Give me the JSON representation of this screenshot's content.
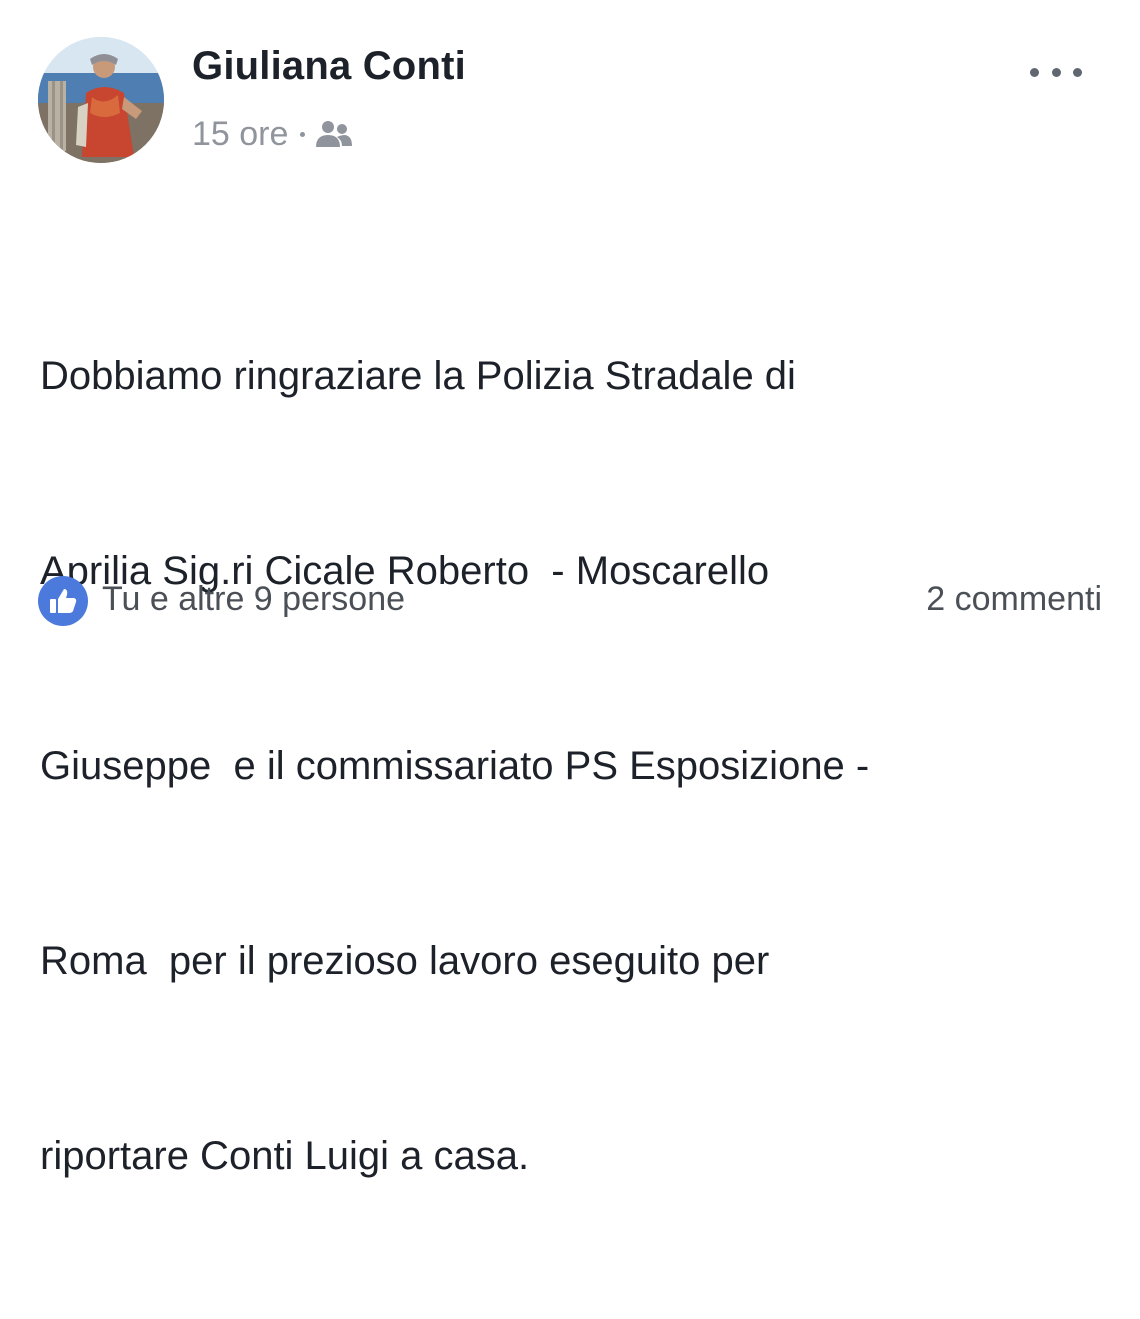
{
  "post": {
    "author": "Giuliana Conti",
    "time": "15 ore",
    "audience_icon": "friends-icon",
    "more_icon": "more-options-icon",
    "text_lines": [
      "Dobbiamo ringraziare la Polizia Stradale di",
      "Aprilia Sig.ri Cicale Roberto  - Moscarello",
      "Giuseppe  e il commissariato PS Esposizione -",
      "Roma  per il prezioso lavoro eseguito per",
      "riportare Conti Luigi a casa."
    ],
    "reactions": {
      "icon": "like-icon",
      "text": "Tu e altre 9 persone",
      "color": "#4c79dc"
    },
    "comments": "2 commenti"
  }
}
